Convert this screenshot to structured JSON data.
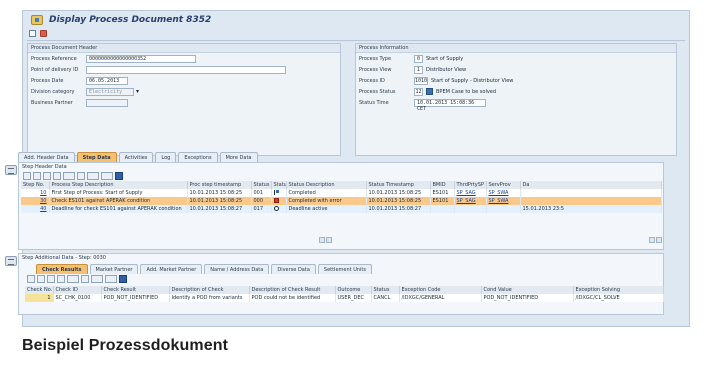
{
  "title": "Display Process Document 8352",
  "header_panel": {
    "title": "Process Document Header",
    "fields": [
      {
        "label": "Process Reference",
        "value": "0000000000000000352",
        "disabled": false,
        "width": 110
      },
      {
        "label": "Point of delivery ID",
        "value": "",
        "disabled": false,
        "width": 200
      },
      {
        "label": "Process Date",
        "value": "06.05.2013",
        "disabled": false,
        "width": 42
      },
      {
        "label": "Division category",
        "value": "Electricity",
        "disabled": true,
        "width": 48,
        "dropdown": true
      },
      {
        "label": "Business Partner",
        "value": "",
        "disabled": true,
        "width": 42
      }
    ]
  },
  "info_panel": {
    "title": "Process Information",
    "fields": [
      {
        "label": "Process Type",
        "code": "0",
        "text": "Start of Supply"
      },
      {
        "label": "Process View",
        "code": "1",
        "text": "Distributor View"
      },
      {
        "label": "Process ID",
        "code": "1010",
        "text": "Start of Supply - Distributor View"
      },
      {
        "label": "Process Status",
        "code": "12",
        "text": "BPEM Case to be solved",
        "status_icon": true
      },
      {
        "label": "Status Time",
        "code": "10.01.2013 15:08:36 CET",
        "text": ""
      }
    ]
  },
  "main_tabs": [
    "Add. Header Data",
    "Step Data",
    "Activities",
    "Log",
    "Exceptions",
    "More Data"
  ],
  "main_tabs_active": 1,
  "step_header": {
    "title": "Step Header Data",
    "columns": [
      "Step No.",
      "Process Step Description",
      "Proc step timestamp",
      "Status",
      "Status",
      "Status Description",
      "Status Timestamp",
      "BMID",
      "ThrdPrtySP",
      "ServProv",
      "Da"
    ],
    "rows": [
      {
        "step": "10",
        "desc": "First Step of Process: Start of Supply",
        "ts": "10.01.2013 15:08:25",
        "status": "001",
        "icon": "flag",
        "sdesc": "Completed",
        "sts": "10.01.2013 15:08:25",
        "bmid": "ES101",
        "tp": "SP_SAG",
        "sp": "SP_SWA",
        "da": "",
        "style": "row-w"
      },
      {
        "step": "30",
        "desc": "Check ES101 against APERAK condition",
        "ts": "10.01.2013 15:08:25",
        "status": "000",
        "icon": "err",
        "sdesc": "Completed with error",
        "sts": "10.01.2013 15:08:25",
        "bmid": "ES101",
        "tp": "SP_SAG",
        "sp": "SP_SWA",
        "da": "",
        "style": "row-sel"
      },
      {
        "step": "40",
        "desc": "Deadline for check ES101 against APERAK condition",
        "ts": "10.01.2013 15:08:27",
        "status": "017",
        "icon": "clock",
        "sdesc": "Deadline active",
        "sts": "10.01.2013 15:08:27",
        "bmid": "",
        "tp": "",
        "sp": "",
        "da": "15.01.2013 23:5",
        "style": "row-b"
      }
    ]
  },
  "step_additional": {
    "title": "Step Additional Data - Step: 0030",
    "tabs": [
      "Check Results",
      "Market Partner",
      "Add. Market Partner",
      "Name / Address Data",
      "Diverse Data",
      "Settlement Units"
    ],
    "active_tab": 0,
    "columns": [
      "Check No.",
      "Check ID",
      "Check Result",
      "Description of Check",
      "Description of Check Result",
      "Outcome",
      "Status",
      "Exception Code",
      "Cond Value",
      "Exception Solving"
    ],
    "rows": [
      {
        "no": "1",
        "id": "SC_CHK_0100",
        "result": "POD_NOT_IDENTIFIED",
        "desc": "Identify a POD from variants",
        "rdesc": "POD could not be identified",
        "outcome": "USER_DEC",
        "status": "CANCL",
        "exc": "/IDXGC/GENERAL",
        "cond": "POD_NOT_IDENTIFIED",
        "solve": "/IDXGC/CL_SOLVE"
      }
    ]
  },
  "caption": "Beispiel Prozessdokument"
}
